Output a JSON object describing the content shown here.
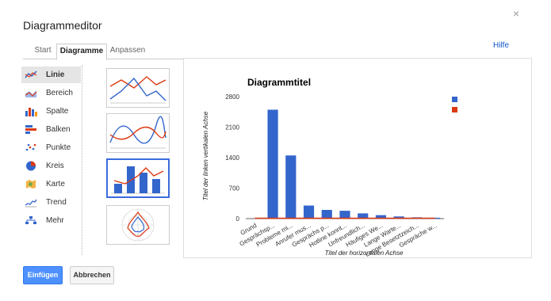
{
  "dialog": {
    "title": "Diagrammeditor",
    "help_label": "Hilfe",
    "close_glyph": "×"
  },
  "tabs": [
    {
      "label": "Start",
      "active": false
    },
    {
      "label": "Diagramme",
      "active": true
    },
    {
      "label": "Anpassen",
      "active": false
    }
  ],
  "chart_types": [
    {
      "label": "Linie",
      "icon": "line-chart-icon",
      "active": true
    },
    {
      "label": "Bereich",
      "icon": "area-chart-icon",
      "active": false
    },
    {
      "label": "Spalte",
      "icon": "column-chart-icon",
      "active": false
    },
    {
      "label": "Balken",
      "icon": "bar-chart-icon",
      "active": false
    },
    {
      "label": "Punkte",
      "icon": "scatter-chart-icon",
      "active": false
    },
    {
      "label": "Kreis",
      "icon": "pie-chart-icon",
      "active": false
    },
    {
      "label": "Karte",
      "icon": "map-chart-icon",
      "active": false
    },
    {
      "label": "Trend",
      "icon": "trend-chart-icon",
      "active": false
    },
    {
      "label": "Mehr",
      "icon": "more-charts-icon",
      "active": false
    }
  ],
  "thumbnails": [
    {
      "name": "line-chart-thumbnail",
      "selected": false
    },
    {
      "name": "curved-line-chart-thumbnail",
      "selected": false
    },
    {
      "name": "combo-chart-thumbnail",
      "selected": true
    },
    {
      "name": "radar-chart-thumbnail",
      "selected": false
    }
  ],
  "buttons": {
    "insert_label": "Einfügen",
    "cancel_label": "Abbrechen"
  },
  "colors": {
    "series_blue": "#3366cc",
    "series_red": "#dc3912",
    "accent": "#4d90fe"
  },
  "chart_data": {
    "type": "bar",
    "title": "Diagrammtitel",
    "xlabel": "Titel der horizontalen Achse",
    "ylabel": "Titel der linken vertikalen Achse",
    "categories": [
      "Grund",
      "Gesprächsp...",
      "Probleme mi...",
      "Anrufer mus...",
      "Gesprächs p...",
      "Hotline konnt...",
      "Unfreundlich...",
      "Häufiges We...",
      "Lange Warte...",
      "Lange Besetztzeich...",
      "Gespräche w..."
    ],
    "series": [
      {
        "values": [
          0,
          2500,
          1450,
          300,
          200,
          180,
          120,
          80,
          50,
          30,
          20
        ]
      },
      {
        "values": [
          0,
          0,
          0,
          0,
          0,
          0,
          0,
          0,
          0,
          0,
          0
        ]
      }
    ],
    "ylim": [
      0,
      2800
    ],
    "yticks": [
      "0",
      "700",
      "1400",
      "2100",
      "2800"
    ],
    "legend_position": "right",
    "grid": false
  }
}
